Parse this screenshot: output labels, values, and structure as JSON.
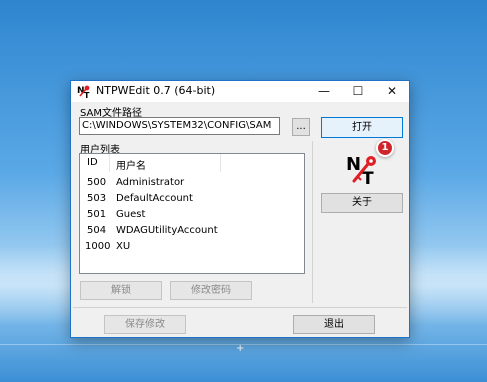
{
  "window": {
    "title": "NTPWEdit 0.7 (64-bit)",
    "controls": {
      "minimize": "—",
      "maximize": "☐",
      "close": "✕"
    }
  },
  "sam": {
    "label": "SAM文件路径",
    "path": "C:\\WINDOWS\\SYSTEM32\\CONFIG\\SAM",
    "browse_label": "...",
    "open_label": "打开"
  },
  "users": {
    "label": "用户列表",
    "columns": [
      "ID",
      "用户名"
    ],
    "rows": [
      {
        "id": "500",
        "name": "Administrator"
      },
      {
        "id": "503",
        "name": "DefaultAccount"
      },
      {
        "id": "501",
        "name": "Guest"
      },
      {
        "id": "504",
        "name": "WDAGUtilityAccount"
      },
      {
        "id": "1000",
        "name": "XU"
      }
    ]
  },
  "buttons": {
    "about": "关于",
    "unlock": "解锁",
    "change_password": "修改密码",
    "save": "保存修改",
    "exit": "退出"
  },
  "annotation": {
    "badge": "1"
  },
  "colors": {
    "accent": "#0078d7",
    "badge": "#d0262b",
    "logo_red": "#e01e25"
  },
  "icons": [
    "app-icon",
    "ntpwedit-logo-icon",
    "minimize-icon",
    "maximize-icon",
    "close-icon"
  ]
}
